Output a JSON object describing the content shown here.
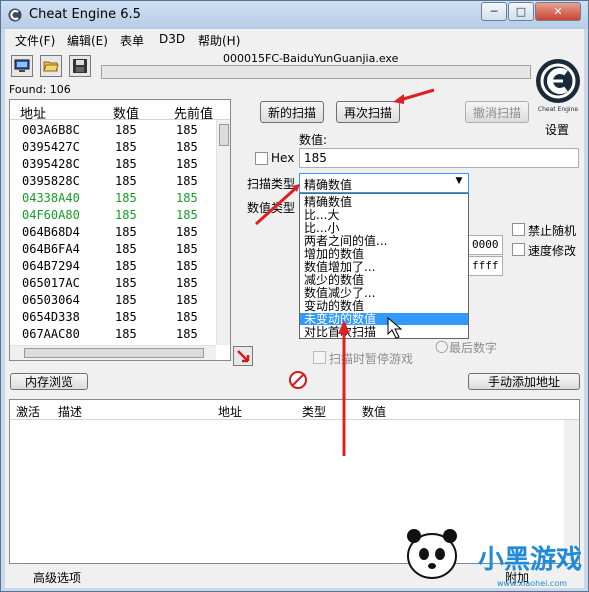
{
  "window": {
    "title": "Cheat Engine 6.5",
    "minimize": "─",
    "maximize": "□",
    "close": "✕"
  },
  "menu": [
    "文件(F)",
    "编辑(E)",
    "表单",
    "D3D",
    "帮助(H)"
  ],
  "toolbar": {
    "icons": [
      "computer-icon",
      "open-folder-icon",
      "save-disk-icon"
    ]
  },
  "process": "000015FC-BaiduYunGuanjia.exe",
  "found": "Found: 106",
  "settings_label": "设置",
  "logo_caption": "Cheat Engine",
  "results": {
    "headers": [
      "地址",
      "数值",
      "先前值"
    ],
    "rows": [
      {
        "addr": "003A6B8C",
        "value": "185",
        "prev": "185",
        "green": false
      },
      {
        "addr": "0395427C",
        "value": "185",
        "prev": "185",
        "green": false
      },
      {
        "addr": "0395428C",
        "value": "185",
        "prev": "185",
        "green": false
      },
      {
        "addr": "0395828C",
        "value": "185",
        "prev": "185",
        "green": false
      },
      {
        "addr": "04338A40",
        "value": "185",
        "prev": "185",
        "green": true
      },
      {
        "addr": "04F60A80",
        "value": "185",
        "prev": "185",
        "green": true
      },
      {
        "addr": "064B68D4",
        "value": "185",
        "prev": "185",
        "green": false
      },
      {
        "addr": "064B6FA4",
        "value": "185",
        "prev": "185",
        "green": false
      },
      {
        "addr": "064B7294",
        "value": "185",
        "prev": "185",
        "green": false
      },
      {
        "addr": "065017AC",
        "value": "185",
        "prev": "185",
        "green": false
      },
      {
        "addr": "06503064",
        "value": "185",
        "prev": "185",
        "green": false
      },
      {
        "addr": "0654D338",
        "value": "185",
        "prev": "185",
        "green": false
      },
      {
        "addr": "067AAC80",
        "value": "185",
        "prev": "185",
        "green": false
      }
    ]
  },
  "scan": {
    "new_scan": "新的扫描",
    "next_scan": "再次扫描",
    "undo_scan": "撤消扫描",
    "value_label": "数值:",
    "hex_label": "Hex",
    "value": "185",
    "scan_type_label": "扫描类型",
    "scan_type_selected": "精确数值",
    "value_type_label": "数值类型",
    "options": [
      "精确数值",
      "比...大",
      "比...小",
      "两者之间的值...",
      "增加的数值",
      "数值增加了...",
      "减少的数值",
      "数值减少了...",
      "变动的数值",
      "未变动的数值",
      "对比首次扫描"
    ],
    "highlighted_option": 9,
    "range_start": "0000",
    "range_stop": "ffff",
    "disable_random": "禁止随机",
    "speedhack": "速度修改",
    "last_digits": "最后数字",
    "pause_game": "扫描时暂停游戏"
  },
  "buttons": {
    "memory_view": "内存浏览",
    "add_address": "手动添加地址",
    "advanced": "高级选项",
    "extra": "附加"
  },
  "address_list": {
    "headers": [
      "激活",
      "描述",
      "地址",
      "类型",
      "数值"
    ]
  },
  "watermark": {
    "text": "小黑游戏",
    "url": "www.xiaohei.com"
  },
  "colors": {
    "highlight": "#3399ff",
    "arrow": "#e02020",
    "green_text": "#159e26"
  }
}
